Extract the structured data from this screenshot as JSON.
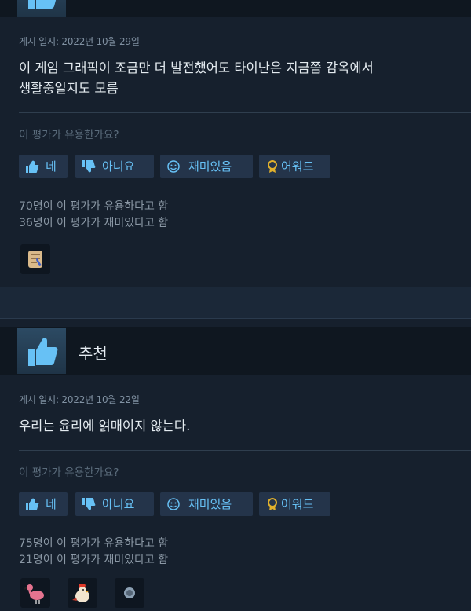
{
  "reviews": [
    {
      "recommend_label": "",
      "posted": "게시 일시: 2022년 10월 29일",
      "body_lines": [
        "이 게임 그래픽이 조금만 더 발전했어도 타이난은 지금쯤 감옥에서",
        "생활중일지도 모름"
      ],
      "helpful_question": "이 평가가 유용한가요?",
      "buttons": {
        "yes": "네",
        "no": "아니요",
        "funny": "재미있음",
        "award": "어워드"
      },
      "stats": [
        "70명이 이 평가가 유용하다고 함",
        "36명이 이 평가가 재미있다고 함"
      ],
      "awards": [
        "scroll-award-icon"
      ]
    },
    {
      "recommend_label": "추천",
      "posted": "게시 일시: 2022년 10월 22일",
      "body_lines": [
        "우리는 윤리에 얽매이지 않는다."
      ],
      "helpful_question": "이 평가가 유용한가요?",
      "buttons": {
        "yes": "네",
        "no": "아니요",
        "funny": "재미있음",
        "award": "어워드"
      },
      "stats": [
        "75명이 이 평가가 유용하다고 함",
        "21명이 이 평가가 재미있다고 함"
      ],
      "awards": [
        "flamingo-award-icon",
        "rooster-award-icon",
        "coin-award-icon"
      ]
    }
  ],
  "colors": {
    "link": "#67c1f5",
    "award_gold": "#e1b12c",
    "panel": "#16202d",
    "page": "#1b2838"
  }
}
